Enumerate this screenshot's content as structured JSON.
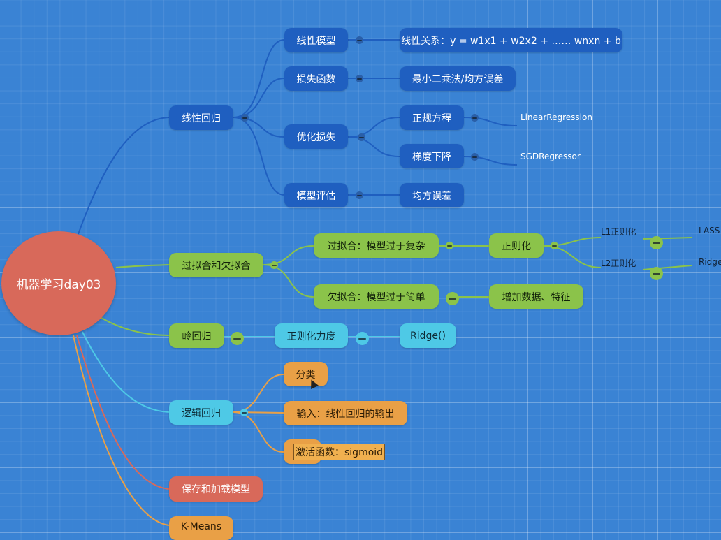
{
  "root": {
    "label": "机器学习day03"
  },
  "linear_regression": {
    "label": "线性回归",
    "children": {
      "model": {
        "label": "线性模型",
        "detail": "线性关系：y = w1x1 + w2x2 + …… wnxn + b"
      },
      "loss": {
        "label": "损失函数",
        "detail": "最小二乘法/均方误差"
      },
      "optimize": {
        "label": "优化损失",
        "normal_equation": {
          "label": "正规方程",
          "api": "LinearRegression"
        },
        "gradient_descent": {
          "label": "梯度下降",
          "api": "SGDRegressor"
        }
      },
      "evaluate": {
        "label": "模型评估",
        "detail": "均方误差"
      }
    }
  },
  "fitting": {
    "label": "过拟合和欠拟合",
    "overfit": {
      "label": "过拟合：模型过于复杂",
      "regularization": {
        "label": "正则化",
        "l1": "L1正则化",
        "l1_leaf": "LASS",
        "l2": "L2正则化",
        "l2_leaf": "Ridge"
      }
    },
    "underfit": {
      "label": "欠拟合：模型过于简单",
      "fix": "增加数据、特征"
    }
  },
  "ridge": {
    "label": "岭回归",
    "strength": "正则化力度",
    "api": "Ridge()"
  },
  "logistic": {
    "label": "逻辑回归",
    "classify": "分类",
    "input": "输入：线性回归的输出",
    "activation": "激活函数：sigmoid"
  },
  "save_load": {
    "label": "保存和加载模型"
  },
  "kmeans": {
    "label": "K-Means"
  },
  "colors": {
    "background": "#3a83d4",
    "blue_branch": "#1f5fc0",
    "green_branch": "#8bc34a",
    "cyan_branch": "#4ec9e6",
    "orange_branch": "#e9a046",
    "red_branch": "#d8695a"
  }
}
